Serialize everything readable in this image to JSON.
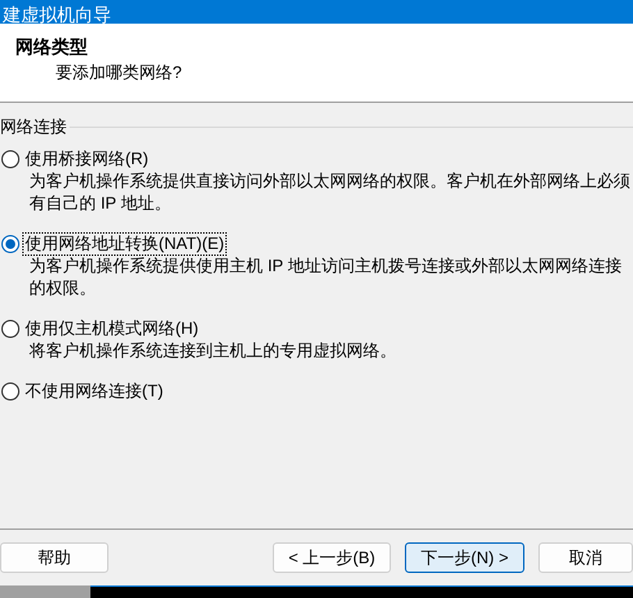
{
  "window": {
    "title": "建虚拟机向导"
  },
  "header": {
    "title": "网络类型",
    "subtitle": "要添加哪类网络?"
  },
  "group": {
    "label": "网络连接"
  },
  "options": [
    {
      "label": "使用桥接网络(R)",
      "description": "为客户机操作系统提供直接访问外部以太网网络的权限。客户机在外部网络上必须有自己的 IP 地址。",
      "selected": false
    },
    {
      "label": "使用网络地址转换(NAT)(E)",
      "description": "为客户机操作系统提供使用主机 IP 地址访问主机拨号连接或外部以太网网络连接的权限。",
      "selected": true
    },
    {
      "label": "使用仅主机模式网络(H)",
      "description": "将客户机操作系统连接到主机上的专用虚拟网络。",
      "selected": false
    },
    {
      "label": "不使用网络连接(T)",
      "selected": false
    }
  ],
  "buttons": [
    {
      "label": "帮助",
      "kind": "help",
      "default": false
    },
    {
      "label": "< 上一步(B)",
      "kind": "back",
      "default": false
    },
    {
      "label": "下一步(N) >",
      "kind": "next",
      "default": true
    },
    {
      "label": "取消",
      "kind": "cancel",
      "default": false
    }
  ]
}
